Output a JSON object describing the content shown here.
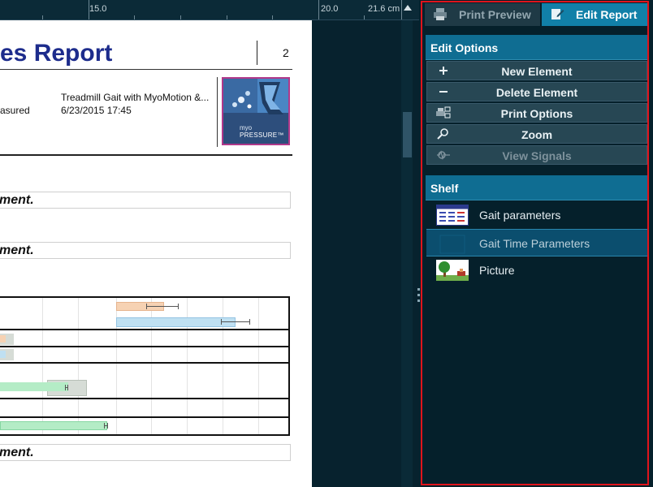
{
  "ruler": {
    "labels": [
      "15.0",
      "20.0",
      "21.6 cm"
    ]
  },
  "report": {
    "title": "es Report",
    "page_number": "2",
    "header": {
      "test_name": "Treadmill Gait with MyoMotion &...",
      "measured_label": "asured",
      "measured_date": "6/23/2015 17:45"
    },
    "logo": {
      "line1": "myo",
      "line2": "PRESSURE™"
    },
    "comments": [
      "ment.",
      "ment.",
      "ment."
    ]
  },
  "panel": {
    "tabs": [
      {
        "label": "Print Preview",
        "icon": "printer-icon",
        "active": false
      },
      {
        "label": "Edit Report",
        "icon": "edit-icon",
        "active": true
      }
    ],
    "edit_options": {
      "header": "Edit Options",
      "buttons": [
        {
          "label": "New Element",
          "icon": "plus-icon",
          "enabled": true
        },
        {
          "label": "Delete Element",
          "icon": "minus-icon",
          "enabled": true
        },
        {
          "label": "Print Options",
          "icon": "print-options-icon",
          "enabled": true
        },
        {
          "label": "Zoom",
          "icon": "magnifier-icon",
          "enabled": true
        },
        {
          "label": "View Signals",
          "icon": "signals-icon",
          "enabled": false
        }
      ]
    },
    "shelf": {
      "header": "Shelf",
      "items": [
        {
          "label": "Gait parameters",
          "icon": "table-icon",
          "selected": false
        },
        {
          "label": "Gait Time Parameters",
          "icon": "blank-icon",
          "selected": true
        },
        {
          "label": "Picture",
          "icon": "picture-icon",
          "selected": false
        }
      ]
    }
  },
  "colors": {
    "accent": "#1180a8",
    "highlight_border": "#e0141c",
    "bar_orange": "#f6d2b3",
    "bar_blue": "#bfe0f2",
    "bar_green": "#b4ecc6",
    "bar_gray": "#d6dcd6"
  }
}
